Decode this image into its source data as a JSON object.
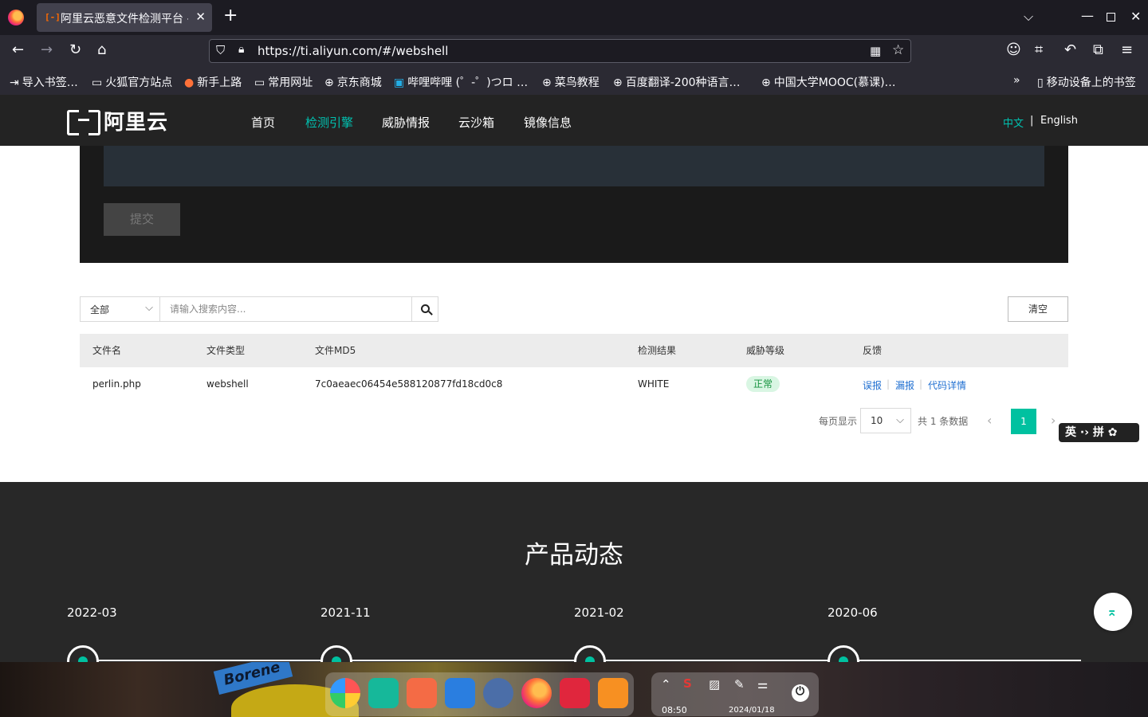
{
  "browser": {
    "tab_icon": "[-]",
    "tab_title": "阿里云恶意文件检测平台 -",
    "tab_close": "✕",
    "new_tab": "+",
    "url": "https://ti.aliyun.com/#/webshell",
    "bookmarks": [
      {
        "icon": "import-icon",
        "glyph": "⇥",
        "label": "导入书签…"
      },
      {
        "icon": "folder-icon",
        "glyph": "▭",
        "label": "火狐官方站点"
      },
      {
        "icon": "firefox-icon",
        "glyph": "●",
        "label": "新手上路"
      },
      {
        "icon": "folder-icon",
        "glyph": "▭",
        "label": "常用网址"
      },
      {
        "icon": "globe-icon",
        "glyph": "⊕",
        "label": "京东商城"
      },
      {
        "icon": "bilibili-icon",
        "glyph": "▣",
        "label": "哔哩哔哩 (゜-゜)つロ …"
      },
      {
        "icon": "globe-icon",
        "glyph": "⊕",
        "label": "菜鸟教程"
      },
      {
        "icon": "globe-icon",
        "glyph": "⊕",
        "label": "百度翻译-200种语言…"
      },
      {
        "icon": "globe-icon",
        "glyph": "⊕",
        "label": "中国大学MOOC(慕课)…"
      }
    ],
    "mobile_bookmarks": "移动设备上的书签"
  },
  "site": {
    "logo_text": "阿里云",
    "nav": [
      "首页",
      "检测引擎",
      "威胁情报",
      "云沙箱",
      "镜像信息"
    ],
    "active_nav": "检测引擎",
    "lang_zh": "中文",
    "lang_sep": "|",
    "lang_en": "English"
  },
  "upload": {
    "submit_label": "提交"
  },
  "search": {
    "filter_value": "全部",
    "placeholder": "请输入搜索内容...",
    "clear_label": "清空"
  },
  "table": {
    "headers": [
      "文件名",
      "文件类型",
      "文件MD5",
      "检测结果",
      "威胁等级",
      "反馈"
    ],
    "rows": [
      {
        "filename": "perlin.php",
        "type": "webshell",
        "md5": "7c0aeaec06454e588120877fd18cd0c8",
        "result": "WHITE",
        "level": "正常",
        "feedback": [
          "误报",
          "漏报",
          "代码详情"
        ]
      }
    ]
  },
  "pagination": {
    "per_page_label": "每页显示",
    "per_page": "10",
    "total_text": "共 1 条数据",
    "current_page": "1"
  },
  "ime": {
    "text": "英 ·› 拼 ✿"
  },
  "news": {
    "title": "产品动态",
    "dates": [
      "2022-03",
      "2021-11",
      "2021-02",
      "2020-06"
    ]
  },
  "taskbar": {
    "time": "08:50",
    "date": "2024/01/18",
    "wallpaper_text": "Borene"
  },
  "colors": {
    "accent": "#00c1b0",
    "browser_dark": "#1c1b22",
    "site_header": "#232323",
    "link": "#1f6fd1"
  }
}
